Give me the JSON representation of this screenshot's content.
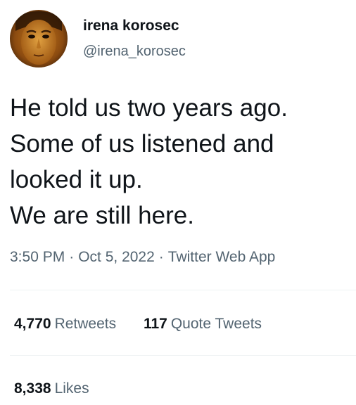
{
  "author": {
    "display_name": "irena korosec",
    "handle": "@irena_korosec",
    "avatar_icon": "profile-photo"
  },
  "tweet": {
    "lines": [
      "He told us two years ago.",
      "Some of us listened and",
      "looked it up.",
      "We are still here."
    ]
  },
  "meta": {
    "time": "3:50 PM",
    "separator": "·",
    "date": "Oct 5, 2022",
    "source": "Twitter Web App"
  },
  "stats": {
    "retweets_count": "4,770",
    "retweets_label": "Retweets",
    "quotes_count": "117",
    "quotes_label": "Quote Tweets",
    "likes_count": "8,338",
    "likes_label": "Likes"
  },
  "colors": {
    "text_primary": "#0f1419",
    "text_secondary": "#536471",
    "divider": "#eff3f4"
  }
}
